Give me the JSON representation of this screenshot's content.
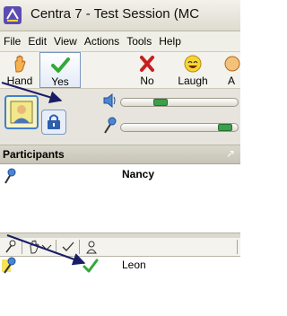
{
  "window": {
    "title": "Centra 7 - Test Session (MC",
    "app_icon": "centra-logo-icon"
  },
  "menubar": {
    "items": [
      "File",
      "Edit",
      "View",
      "Actions",
      "Tools",
      "Help"
    ]
  },
  "toolbar": {
    "buttons": [
      {
        "label": "Hand",
        "icon": "raise-hand-icon"
      },
      {
        "label": "Yes",
        "icon": "check-icon",
        "active": true
      },
      {
        "label": "No",
        "icon": "x-icon"
      },
      {
        "label": "Laugh",
        "icon": "smiley-icon"
      },
      {
        "label": "A",
        "icon": "applause-icon"
      }
    ]
  },
  "audio": {
    "speaker_level": 0.32,
    "mic_level": 0.95,
    "icons": [
      "video-icon",
      "lock-icon",
      "speaker-icon",
      "microphone-icon"
    ]
  },
  "participants_panel": {
    "title": "Participants",
    "presenter": {
      "name": "Nancy",
      "icon": "microphone-icon"
    },
    "columns_icons": [
      "microphone-icon",
      "hand-icon",
      "check-icon",
      "person-icon"
    ],
    "rows": [
      {
        "name": "Leon",
        "status": "yes",
        "icon": "check-icon"
      }
    ]
  },
  "colors": {
    "accent": "#3f7fcf",
    "yes_green": "#34a838",
    "no_red": "#c81e1e",
    "slider_green": "#3aa04a",
    "arrow": "#1a1d66"
  }
}
